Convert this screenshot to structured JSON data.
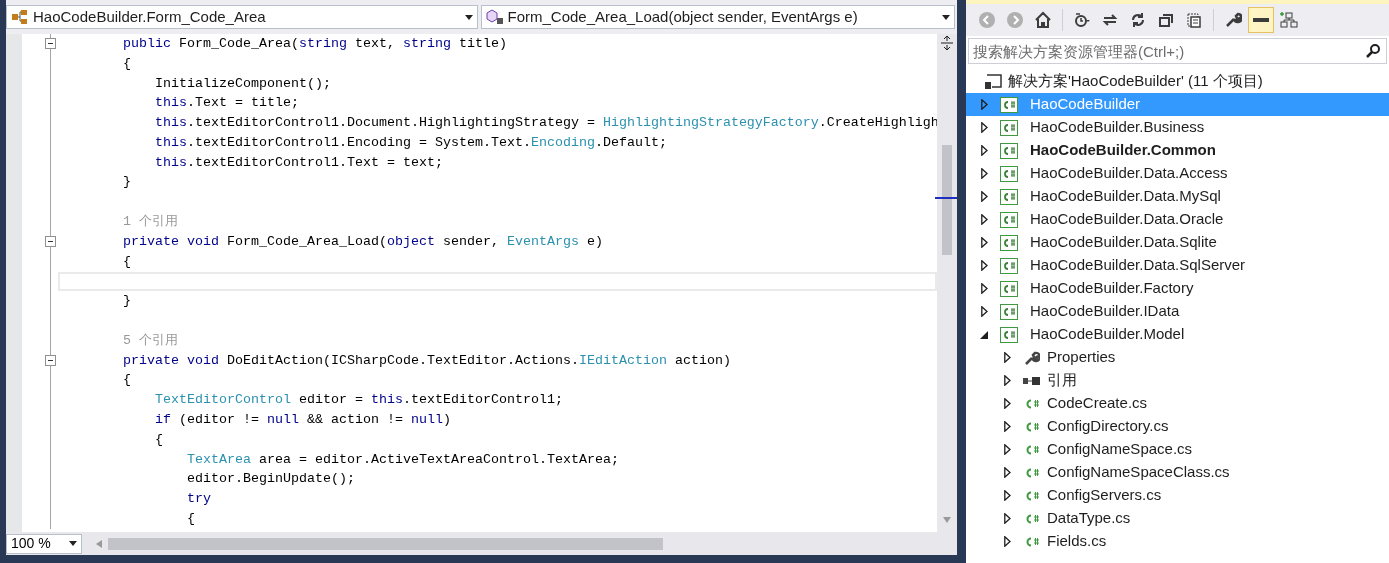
{
  "editor": {
    "class_combo": {
      "value": "HaoCodeBuilder.Form_Code_Area"
    },
    "member_combo": {
      "value": "Form_Code_Area_Load(object sender, EventArgs e)"
    },
    "lines": [
      {
        "kind": "code",
        "fold": true,
        "tokens": [
          {
            "text": "public",
            "kind": "kw"
          },
          {
            "text": " Form_Code_Area(",
            "kind": "plain"
          },
          {
            "text": "string",
            "kind": "kw"
          },
          {
            "text": " text, ",
            "kind": "plain"
          },
          {
            "text": "string",
            "kind": "kw"
          },
          {
            "text": " title)",
            "kind": "plain"
          }
        ]
      },
      {
        "kind": "code",
        "fold": false,
        "tokens": [
          {
            "text": "{",
            "kind": "plain"
          }
        ],
        "children": [
          {
            "kind": "code",
            "fold": false,
            "tokens": [
              {
                "text": "InitializeComponent();",
                "kind": "plain"
              }
            ]
          },
          {
            "kind": "code",
            "fold": false,
            "tokens": [
              {
                "text": "this",
                "kind": "kw"
              },
              {
                "text": ".Text = title;",
                "kind": "plain"
              }
            ]
          },
          {
            "kind": "code",
            "fold": false,
            "tokens": [
              {
                "text": "this",
                "kind": "kw"
              },
              {
                "text": ".textEditorControl1.Document.HighlightingStrategy = ",
                "kind": "plain"
              },
              {
                "text": "HighlightingStrategyFactory",
                "kind": "type"
              },
              {
                "text": ".CreateHighligh",
                "kind": "plain"
              }
            ]
          },
          {
            "kind": "code",
            "fold": false,
            "tokens": [
              {
                "text": "this",
                "kind": "kw"
              },
              {
                "text": ".textEditorControl1.Encoding = System.Text.",
                "kind": "plain"
              },
              {
                "text": "Encoding",
                "kind": "type"
              },
              {
                "text": ".Default;",
                "kind": "plain"
              }
            ]
          },
          {
            "kind": "code",
            "fold": false,
            "tokens": [
              {
                "text": "this",
                "kind": "kw"
              },
              {
                "text": ".textEditorControl1.Text = text;",
                "kind": "plain"
              }
            ]
          }
        ]
      },
      {
        "kind": "code",
        "fold": false,
        "tokens": [
          {
            "text": "}",
            "kind": "plain"
          }
        ]
      },
      {
        "kind": "blank",
        "fold": false
      },
      {
        "kind": "ref",
        "fold": false,
        "text": "1 个引用"
      },
      {
        "kind": "code",
        "fold": true,
        "tokens": [
          {
            "text": "private void",
            "kind": "kw"
          },
          {
            "text": " Form_Code_Area_Load(",
            "kind": "plain"
          },
          {
            "text": "object",
            "kind": "kw"
          },
          {
            "text": " sender, ",
            "kind": "plain"
          },
          {
            "text": "EventArgs",
            "kind": "type"
          },
          {
            "text": " e)",
            "kind": "plain"
          }
        ]
      },
      {
        "kind": "code",
        "fold": false,
        "tokens": [
          {
            "text": "{",
            "kind": "plain"
          }
        ]
      },
      {
        "kind": "cursor",
        "fold": false
      },
      {
        "kind": "code",
        "fold": false,
        "tokens": [
          {
            "text": "}",
            "kind": "plain"
          }
        ]
      },
      {
        "kind": "blank",
        "fold": false
      },
      {
        "kind": "ref",
        "fold": false,
        "text": "5 个引用"
      },
      {
        "kind": "code",
        "fold": true,
        "tokens": [
          {
            "text": "private void",
            "kind": "kw"
          },
          {
            "text": " DoEditAction(ICSharpCode.TextEditor.Actions.",
            "kind": "plain"
          },
          {
            "text": "IEditAction",
            "kind": "type"
          },
          {
            "text": " action)",
            "kind": "plain"
          }
        ]
      },
      {
        "kind": "code",
        "fold": false,
        "tokens": [
          {
            "text": "{",
            "kind": "plain"
          }
        ],
        "children": [
          {
            "kind": "code",
            "fold": false,
            "tokens": [
              {
                "text": "TextEditorControl",
                "kind": "type"
              },
              {
                "text": " editor = ",
                "kind": "plain"
              },
              {
                "text": "this",
                "kind": "kw"
              },
              {
                "text": ".textEditorControl1;",
                "kind": "plain"
              }
            ]
          },
          {
            "kind": "code",
            "fold": false,
            "tokens": [
              {
                "text": "if",
                "kind": "kw"
              },
              {
                "text": " (editor != ",
                "kind": "plain"
              },
              {
                "text": "null",
                "kind": "kw"
              },
              {
                "text": " && action != ",
                "kind": "plain"
              },
              {
                "text": "null",
                "kind": "kw"
              },
              {
                "text": ")",
                "kind": "plain"
              }
            ]
          },
          {
            "kind": "code",
            "fold": false,
            "tokens": [
              {
                "text": "{",
                "kind": "plain"
              }
            ],
            "children": [
              {
                "kind": "code",
                "fold": false,
                "tokens": [
                  {
                    "text": "TextArea",
                    "kind": "type"
                  },
                  {
                    "text": " area = editor.ActiveTextAreaControl.TextArea;",
                    "kind": "plain"
                  }
                ]
              },
              {
                "kind": "code",
                "fold": false,
                "tokens": [
                  {
                    "text": "editor.BeginUpdate();",
                    "kind": "plain"
                  }
                ]
              },
              {
                "kind": "code",
                "fold": false,
                "tokens": [
                  {
                    "text": "try",
                    "kind": "kw"
                  }
                ]
              },
              {
                "kind": "code",
                "fold": false,
                "tokens": [
                  {
                    "text": "{",
                    "kind": "plain"
                  }
                ]
              }
            ]
          }
        ]
      }
    ],
    "zoom_combo": {
      "value": "100 %"
    }
  },
  "solution_explorer": {
    "toolbar": [
      {
        "kind": "back",
        "disabled": true,
        "selected": false
      },
      {
        "kind": "forward",
        "disabled": true,
        "selected": false
      },
      {
        "kind": "home",
        "disabled": false,
        "selected": false
      },
      {
        "kind": "separator"
      },
      {
        "kind": "history",
        "disabled": false,
        "selected": false
      },
      {
        "kind": "sync",
        "disabled": false,
        "selected": false
      },
      {
        "kind": "refresh",
        "disabled": false,
        "selected": false
      },
      {
        "kind": "collapse",
        "disabled": false,
        "selected": false
      },
      {
        "kind": "show-files",
        "disabled": false,
        "selected": false
      },
      {
        "kind": "separator"
      },
      {
        "kind": "properties",
        "disabled": false,
        "selected": false
      },
      {
        "kind": "preview",
        "disabled": false,
        "selected": true
      },
      {
        "kind": "diagram",
        "disabled": false,
        "selected": false
      }
    ],
    "search": {
      "placeholder": "搜索解决方案资源管理器(Ctrl+;)"
    },
    "root": {
      "label": "解决方案'HaoCodeBuilder' (11 个项目)"
    },
    "projects": [
      {
        "label": "HaoCodeBuilder",
        "selected": true,
        "bold": false,
        "expanded": false
      },
      {
        "label": "HaoCodeBuilder.Business",
        "selected": false,
        "bold": false,
        "expanded": false
      },
      {
        "label": "HaoCodeBuilder.Common",
        "selected": false,
        "bold": true,
        "expanded": false
      },
      {
        "label": "HaoCodeBuilder.Data.Access",
        "selected": false,
        "bold": false,
        "expanded": false
      },
      {
        "label": "HaoCodeBuilder.Data.MySql",
        "selected": false,
        "bold": false,
        "expanded": false
      },
      {
        "label": "HaoCodeBuilder.Data.Oracle",
        "selected": false,
        "bold": false,
        "expanded": false
      },
      {
        "label": "HaoCodeBuilder.Data.Sqlite",
        "selected": false,
        "bold": false,
        "expanded": false
      },
      {
        "label": "HaoCodeBuilder.Data.SqlServer",
        "selected": false,
        "bold": false,
        "expanded": false
      },
      {
        "label": "HaoCodeBuilder.Factory",
        "selected": false,
        "bold": false,
        "expanded": false
      },
      {
        "label": "HaoCodeBuilder.IData",
        "selected": false,
        "bold": false,
        "expanded": false
      },
      {
        "label": "HaoCodeBuilder.Model",
        "selected": false,
        "bold": false,
        "expanded": true,
        "children": [
          {
            "kind": "properties",
            "label": "Properties",
            "selected": false,
            "expanded": false
          },
          {
            "kind": "references",
            "label": "引用",
            "selected": false,
            "expanded": false
          },
          {
            "kind": "cs",
            "label": "CodeCreate.cs",
            "selected": false,
            "expanded": false
          },
          {
            "kind": "cs",
            "label": "ConfigDirectory.cs",
            "selected": false,
            "expanded": false
          },
          {
            "kind": "cs",
            "label": "ConfigNameSpace.cs",
            "selected": false,
            "expanded": false
          },
          {
            "kind": "cs",
            "label": "ConfigNameSpaceClass.cs",
            "selected": false,
            "expanded": false
          },
          {
            "kind": "cs",
            "label": "ConfigServers.cs",
            "selected": false,
            "expanded": false
          },
          {
            "kind": "cs",
            "label": "DataType.cs",
            "selected": false,
            "expanded": false
          },
          {
            "kind": "cs",
            "label": "Fields.cs",
            "selected": false,
            "expanded": false
          }
        ]
      }
    ]
  }
}
